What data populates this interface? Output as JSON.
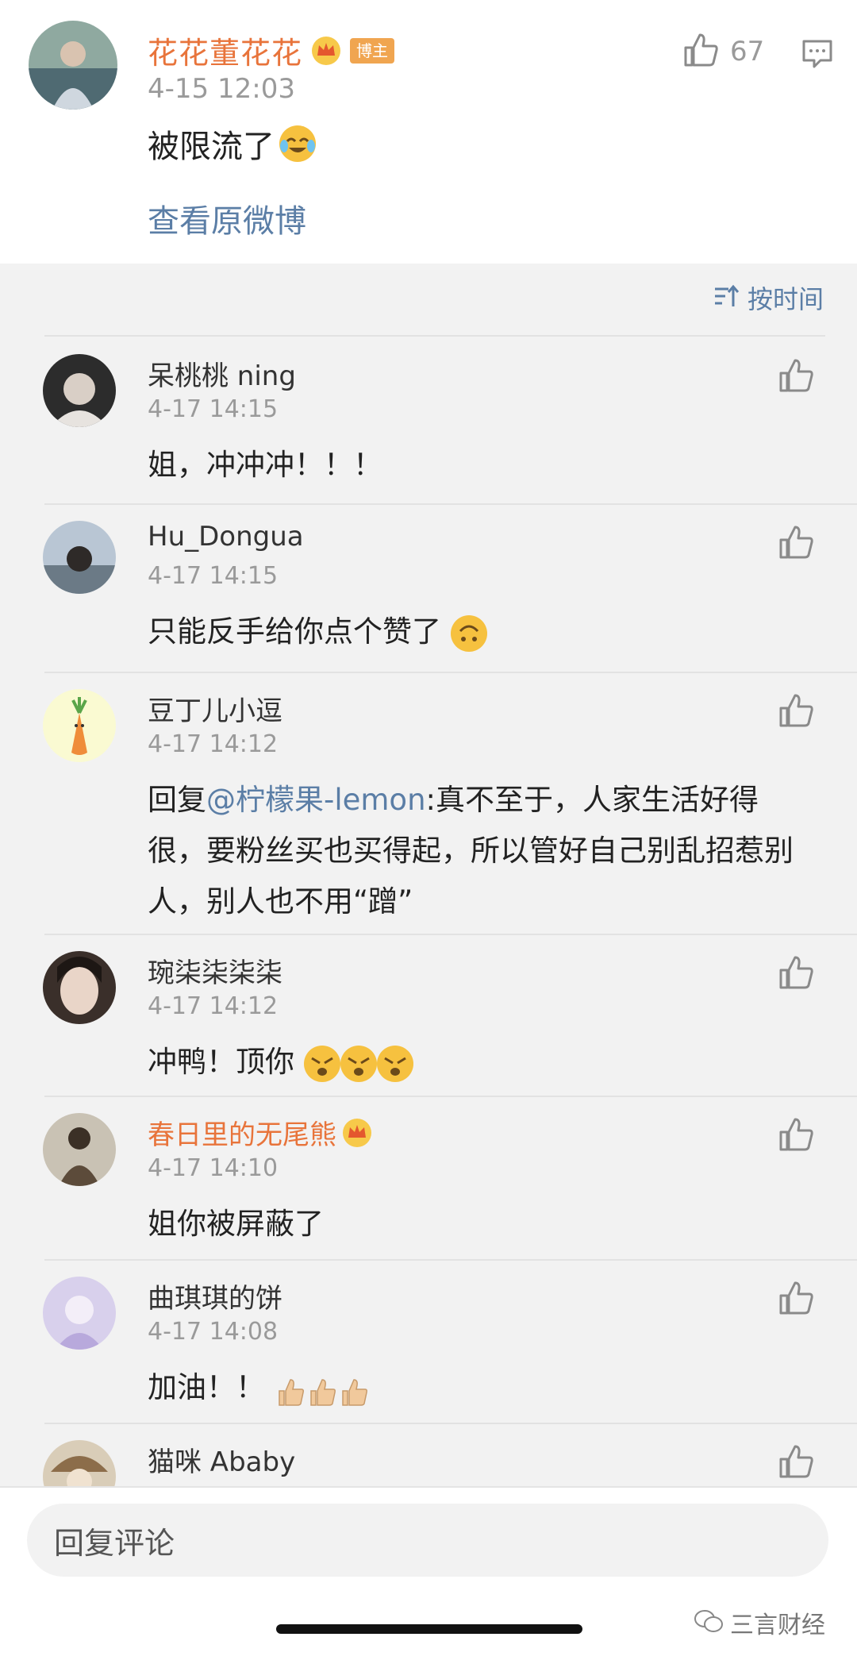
{
  "post": {
    "author": "花花董花花",
    "badge": "博主",
    "time": "4-15 12:03",
    "text": "被限流了",
    "like_count": "67",
    "link": "查看原微博"
  },
  "sort": {
    "label": "按时间"
  },
  "comments": [
    {
      "user": "呆桃桃 ning",
      "time": "4-17 14:15",
      "text": "姐，冲冲冲！！！"
    },
    {
      "user": "Hu_Dongua",
      "time": "4-17 14:15",
      "text": "只能反手给你点个赞了"
    },
    {
      "user": "豆丁儿小逗",
      "time": "4-17 14:12",
      "reply_prefix": "回复",
      "mention": "@柠檬果-lemon",
      "text": ":真不至于，人家生活好得很，要粉丝买也买得起，所以管好自己别乱招惹别人，别人也不用“蹭”"
    },
    {
      "user": "琬柒柒柒柒",
      "time": "4-17 14:12",
      "text": "冲鸭！顶你"
    },
    {
      "user": "春日里的无尾熊",
      "time": "4-17 14:10",
      "text": "姐你被屏蔽了"
    },
    {
      "user": "曲琪琪的饼",
      "time": "4-17 14:08",
      "text": "加油！！"
    },
    {
      "user": "猫咪 Ababy",
      "time": "",
      "text": ""
    }
  ],
  "reply_bar": {
    "placeholder": "回复评论"
  },
  "watermark": "三言财经",
  "colors": {
    "accent_orange": "#e8743b",
    "link_blue": "#5b7ea6",
    "badge": "#f0a550"
  }
}
